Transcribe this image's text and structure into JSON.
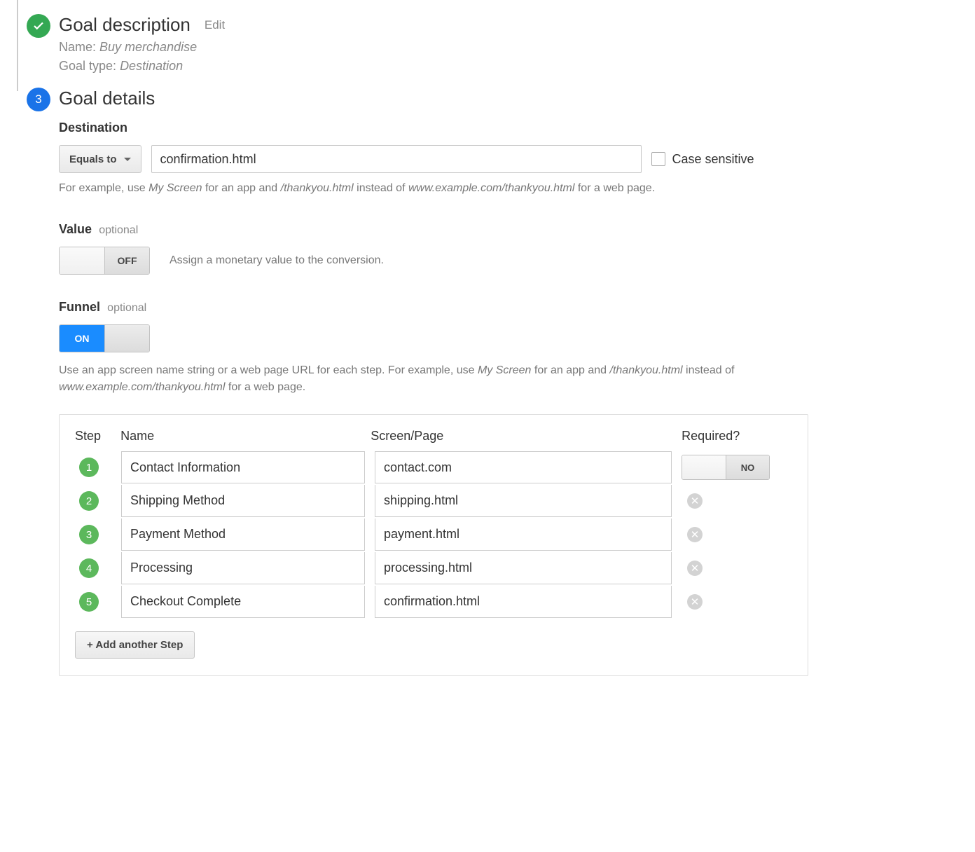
{
  "step1": {
    "title": "Goal description",
    "edit": "Edit",
    "name_label": "Name:",
    "name_value": "Buy merchandise",
    "type_label": "Goal type:",
    "type_value": "Destination"
  },
  "step3": {
    "number": "3",
    "title": "Goal details",
    "destination": {
      "label": "Destination",
      "dropdown": "Equals to",
      "value": "confirmation.html",
      "case_sensitive": "Case sensitive",
      "help_pre": "For example, use ",
      "help_i1": "My Screen",
      "help_mid1": " for an app and ",
      "help_i2": "/thankyou.html",
      "help_mid2": " instead of ",
      "help_i3": "www.example.com/thankyou.html",
      "help_post": " for a web page."
    },
    "value_section": {
      "label": "Value",
      "optional": "optional",
      "toggle": "OFF",
      "hint": "Assign a monetary value to the conversion."
    },
    "funnel": {
      "label": "Funnel",
      "optional": "optional",
      "toggle": "ON",
      "help_pre": "Use an app screen name string or a web page URL for each step. For example, use ",
      "help_i1": "My Screen",
      "help_mid1": " for an app and ",
      "help_i2": "/thankyou.html",
      "help_mid2": " instead of ",
      "help_i3": "www.example.com/thankyou.html",
      "help_post": " for a web page."
    },
    "steps": {
      "headers": {
        "step": "Step",
        "name": "Name",
        "page": "Screen/Page",
        "required": "Required?"
      },
      "required_toggle": "NO",
      "rows": [
        {
          "num": "1",
          "name": "Contact Information",
          "page": "contact.com"
        },
        {
          "num": "2",
          "name": "Shipping Method",
          "page": "shipping.html"
        },
        {
          "num": "3",
          "name": "Payment Method",
          "page": "payment.html"
        },
        {
          "num": "4",
          "name": "Processing",
          "page": "processing.html"
        },
        {
          "num": "5",
          "name": "Checkout Complete",
          "page": "confirmation.html"
        }
      ],
      "add_button": "+ Add another Step"
    }
  }
}
